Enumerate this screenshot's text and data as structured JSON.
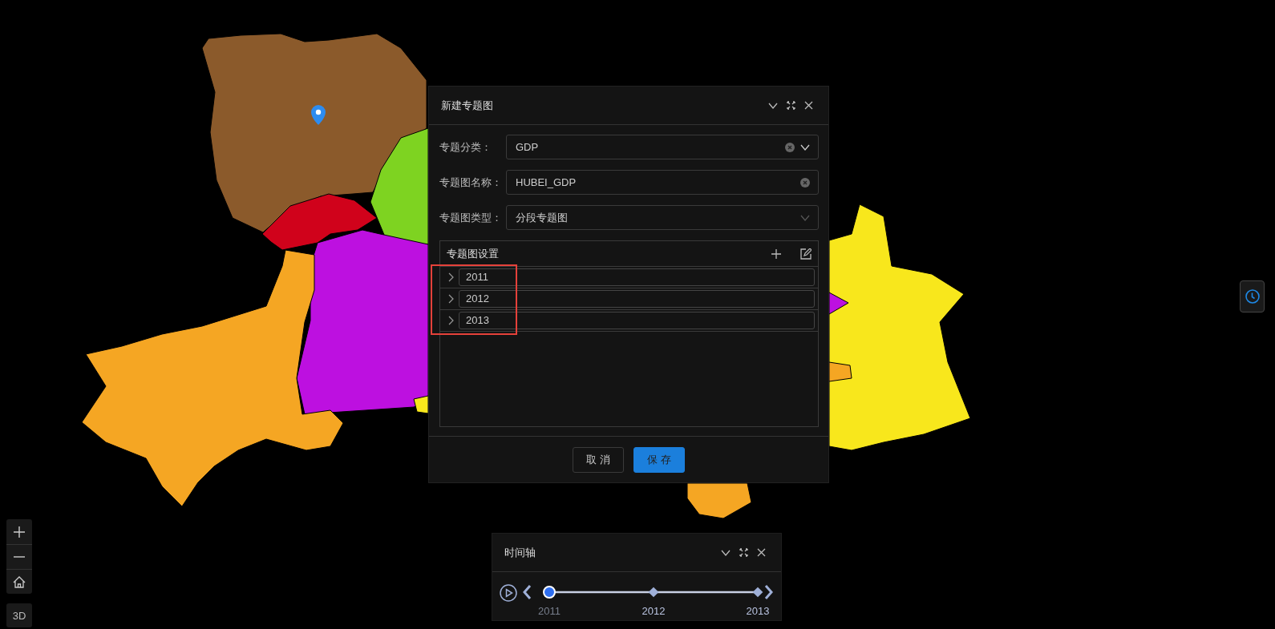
{
  "dialog": {
    "title": "新建专题图",
    "fields": [
      {
        "label": "专题分类：",
        "value": "GDP",
        "kind": "select-clearable"
      },
      {
        "label": "专题图名称：",
        "value": "HUBEI_GDP",
        "kind": "text-clearable"
      },
      {
        "label": "专题图类型：",
        "value": "分段专题图",
        "kind": "select"
      }
    ],
    "settings": {
      "title": "专题图设置",
      "items": [
        {
          "label": "2011",
          "expanded": false
        },
        {
          "label": "2012",
          "expanded": false
        },
        {
          "label": "2013",
          "expanded": false
        }
      ]
    },
    "buttons": [
      {
        "label": "取 消",
        "kind": "default"
      },
      {
        "label": "保 存",
        "kind": "primary"
      }
    ]
  },
  "timeline": {
    "title": "时间轴",
    "stops": [
      {
        "label": "2011",
        "selected": true
      },
      {
        "label": "2012",
        "selected": false
      },
      {
        "label": "2013",
        "selected": false
      }
    ]
  },
  "map_controls": {
    "mode_button": "3D"
  }
}
